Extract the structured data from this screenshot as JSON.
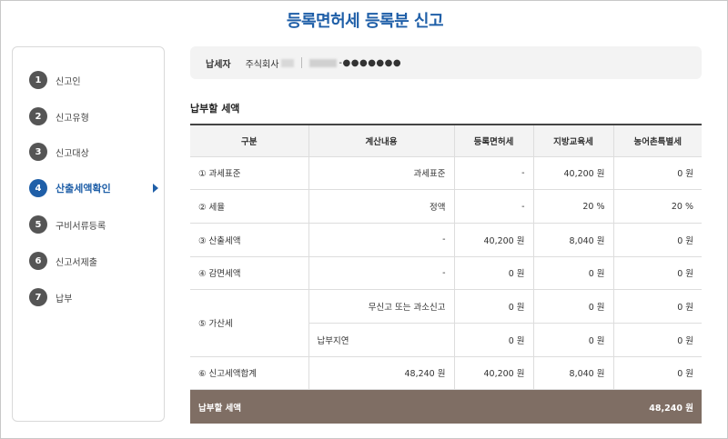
{
  "page": {
    "title": "등록면허세 등록분 신고"
  },
  "steps": [
    {
      "num": "1",
      "label": "신고인"
    },
    {
      "num": "2",
      "label": "신고유형"
    },
    {
      "num": "3",
      "label": "신고대상"
    },
    {
      "num": "4",
      "label": "산출세액확인"
    },
    {
      "num": "5",
      "label": "구비서류등록"
    },
    {
      "num": "6",
      "label": "신고서제출"
    },
    {
      "num": "7",
      "label": "납부"
    }
  ],
  "taxpayer": {
    "label": "납세자",
    "company": "주식회사",
    "masked_id": "-●●●●●●●"
  },
  "section": {
    "title": "납부할 세액"
  },
  "table": {
    "headers": [
      "구분",
      "계산내용",
      "등록면허세",
      "지방교육세",
      "농어촌특별세"
    ],
    "rows": {
      "r1": [
        "① 과세표준",
        "과세표준",
        "-",
        "40,200 원",
        "0 원"
      ],
      "r2": [
        "② 세율",
        "정액",
        "-",
        "20 %",
        "20 %"
      ],
      "r3": [
        "③ 산출세액",
        "-",
        "40,200 원",
        "8,040 원",
        "0 원"
      ],
      "r4": [
        "④ 감면세액",
        "-",
        "0 원",
        "0 원",
        "0 원"
      ],
      "r5a": [
        "⑤ 가산세",
        "무신고 또는 과소신고",
        "0 원",
        "0 원",
        "0 원"
      ],
      "r5b": [
        "납부지연",
        "0 원",
        "0 원",
        "0 원"
      ],
      "r6": [
        "⑥ 신고세액합계",
        "48,240 원",
        "40,200 원",
        "8,040 원",
        "0 원"
      ]
    },
    "total": {
      "label": "납부할 세액",
      "value": "48,240 원"
    }
  }
}
